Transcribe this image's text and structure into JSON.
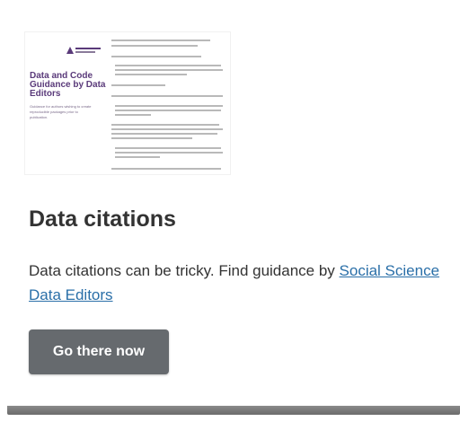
{
  "card": {
    "thumbnail": {
      "logo_text": "Social Science Data Editors",
      "doc_title": "Data and Code Guidance by Data Editors",
      "doc_subtitle": "Guidance for authors wishing to create reproducible packages prior to publication."
    },
    "title": "Data citations",
    "description": "Data citations can be tricky. Find guidance by ",
    "link_text": "Social Science Data Editors",
    "button_label": "Go there now"
  },
  "colors": {
    "title_text": "#333333",
    "link": "#2a6fa8",
    "button_bg": "#666a6e",
    "button_text": "#ffffff",
    "thumbnail_accent": "#5a3a7a"
  }
}
